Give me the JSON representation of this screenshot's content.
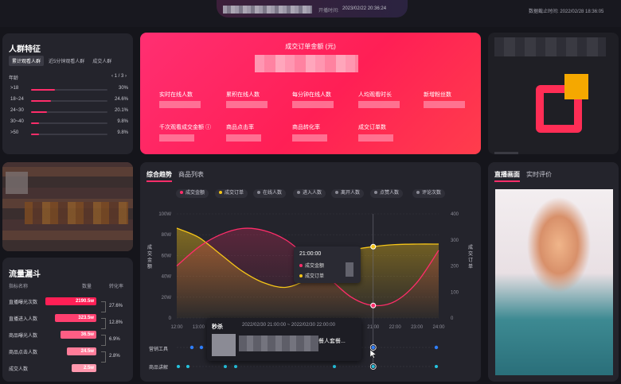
{
  "header": {
    "start_time_label": "开播时间:",
    "start_time": "2023/02/22  20:36:24",
    "cutoff_label": "数据截止时间:",
    "cutoff_time": "2022/02/28  18:36:05"
  },
  "audience": {
    "title": "人群特征",
    "tabs": [
      "累计观看人群",
      "近5分钟观看人群",
      "成交人群"
    ],
    "active_tab": 0,
    "dimension": "年龄",
    "pager": "‹ 1 / 3 ›",
    "rows": [
      {
        "label": ">18",
        "pct": "30%",
        "value": 0.3
      },
      {
        "label": "18~24",
        "pct": "24.6%",
        "value": 0.246
      },
      {
        "label": "24~30",
        "pct": "20.1%",
        "value": 0.201
      },
      {
        "label": "30~40",
        "pct": "9.8%",
        "value": 0.098
      },
      {
        "label": ">50",
        "pct": "9.8%",
        "value": 0.098
      }
    ]
  },
  "funnel": {
    "title": "流量漏斗",
    "col_metric": "指标名称",
    "col_count": "数量",
    "col_rate": "转化率",
    "rows": [
      {
        "label": "直播曝光次数",
        "value": "2190.5w",
        "ratio": 1.0
      },
      {
        "label": "直播进入人数",
        "value": "323.5w",
        "ratio": 0.82
      },
      {
        "label": "商品曝光人数",
        "value": "36.5w",
        "ratio": 0.7
      },
      {
        "label": "商品点击人数",
        "value": "24.5w",
        "ratio": 0.58
      },
      {
        "label": "成交人数",
        "value": "2.5w",
        "ratio": 0.48
      }
    ],
    "rates": [
      "27.6%",
      "12.8%",
      "6.9%",
      "2.8%"
    ]
  },
  "summary": {
    "title": "成交订单金额 (元)",
    "metrics_row1": [
      "实时在线人数",
      "累积在线人数",
      "每分钟在线人数",
      "人均观看时长",
      "新增粉丝数"
    ],
    "metrics_row2": [
      "千次观看成交金额 ⓘ",
      "商品点击率",
      "商品转化率",
      "成交订单数"
    ]
  },
  "trend": {
    "tabs": [
      "综合趋势",
      "商品列表"
    ],
    "active_tab": 0,
    "legend": [
      {
        "name": "成交金额",
        "color": "#ff2d6a",
        "active": true
      },
      {
        "name": "成交订单",
        "color": "#f5c518",
        "active": true
      },
      {
        "name": "在线人数",
        "color": "#8a8a95",
        "active": false
      },
      {
        "name": "进入人数",
        "color": "#8a8a95",
        "active": false
      },
      {
        "name": "离开人数",
        "color": "#8a8a95",
        "active": false
      },
      {
        "name": "点赞人数",
        "color": "#8a8a95",
        "active": false
      },
      {
        "name": "评论次数",
        "color": "#8a8a95",
        "active": false
      }
    ],
    "y_left_label": "成交金额",
    "y_right_label": "成交订单",
    "tooltip": {
      "time": "21:00:00",
      "series": [
        {
          "name": "成交金额",
          "color": "#ff2d6a"
        },
        {
          "name": "成交订单",
          "color": "#f5c518"
        }
      ]
    },
    "track_labels": [
      "营销工具",
      "商品讲解"
    ],
    "flash_sale": {
      "title": "秒杀",
      "time_range": "2022/02/30 21:00:00 ~ 2022/02/30 22:00:00",
      "product": "餐人套餐..."
    }
  },
  "chart_data": {
    "type": "line",
    "x": [
      "12:00",
      "13:00",
      "14:00",
      "15:00",
      "16:00",
      "17:00",
      "18:00",
      "19:00",
      "20:00",
      "21:00",
      "22:00",
      "23:00",
      "24:00"
    ],
    "xlim": [
      0,
      12
    ],
    "y_left_ticks": [
      "0",
      "20W",
      "40W",
      "60W",
      "80W",
      "100W"
    ],
    "y_right_ticks": [
      "0",
      "100",
      "200",
      "300",
      "400"
    ],
    "series": [
      {
        "name": "成交金额",
        "axis": "left",
        "color": "#ff2d6a",
        "points": [
          [
            0,
            50
          ],
          [
            1,
            68
          ],
          [
            2,
            80
          ],
          [
            3,
            86
          ],
          [
            4,
            84
          ],
          [
            5,
            75
          ],
          [
            6,
            58
          ],
          [
            7,
            38
          ],
          [
            8,
            20
          ],
          [
            9,
            12
          ],
          [
            10,
            16
          ],
          [
            11,
            34
          ],
          [
            12,
            65
          ]
        ]
      },
      {
        "name": "成交订单",
        "axis": "right",
        "color": "#f5c518",
        "points": [
          [
            0,
            345
          ],
          [
            1,
            310
          ],
          [
            2,
            245
          ],
          [
            3,
            180
          ],
          [
            4,
            135
          ],
          [
            5,
            118
          ],
          [
            6,
            150
          ],
          [
            7,
            210
          ],
          [
            8,
            258
          ],
          [
            9,
            274
          ],
          [
            10,
            282
          ],
          [
            11,
            284
          ],
          [
            12,
            284
          ]
        ]
      }
    ],
    "highlight_x": 9
  },
  "live": {
    "tabs": [
      "直播画面",
      "实时评价"
    ],
    "active_tab": 0
  }
}
